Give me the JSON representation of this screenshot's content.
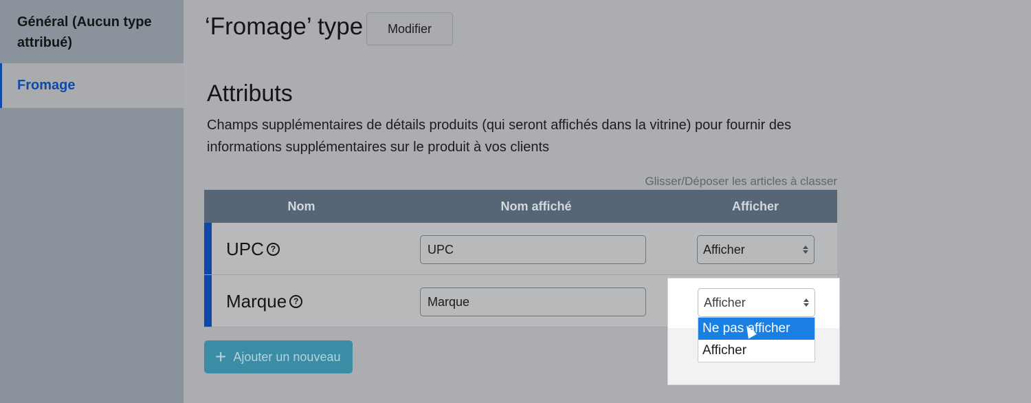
{
  "sidebar": {
    "items": [
      {
        "label": "Général (Aucun type attribué)",
        "active": false
      },
      {
        "label": "Fromage",
        "active": true
      }
    ],
    "accent_color": "#0e4aa8"
  },
  "header": {
    "title": "‘Fromage’ type",
    "modify_button": "Modifier"
  },
  "attributes": {
    "title": "Attributs",
    "description": "Champs supplémentaires de détails produits (qui seront affichés dans la vitrine) pour fournir des informations supplémentaires sur le produit à vos clients",
    "drag_hint": "Glisser/Déposer les articles à classer",
    "columns": [
      "Nom",
      "Nom affiché",
      "Afficher"
    ],
    "rows": [
      {
        "name": "UPC",
        "display_name": "UPC",
        "show": "Afficher",
        "help_icon": "question-circle-icon"
      },
      {
        "name": "Marque",
        "display_name": "Marque",
        "show": "Afficher",
        "help_icon": "question-circle-icon"
      }
    ],
    "add_button": "Ajouter un nouveau"
  },
  "dropdown": {
    "selected": "Afficher",
    "options": [
      "Ne pas afficher",
      "Afficher"
    ],
    "highlighted_option": "Ne pas afficher",
    "highlight_color": "#1a7fe3"
  }
}
